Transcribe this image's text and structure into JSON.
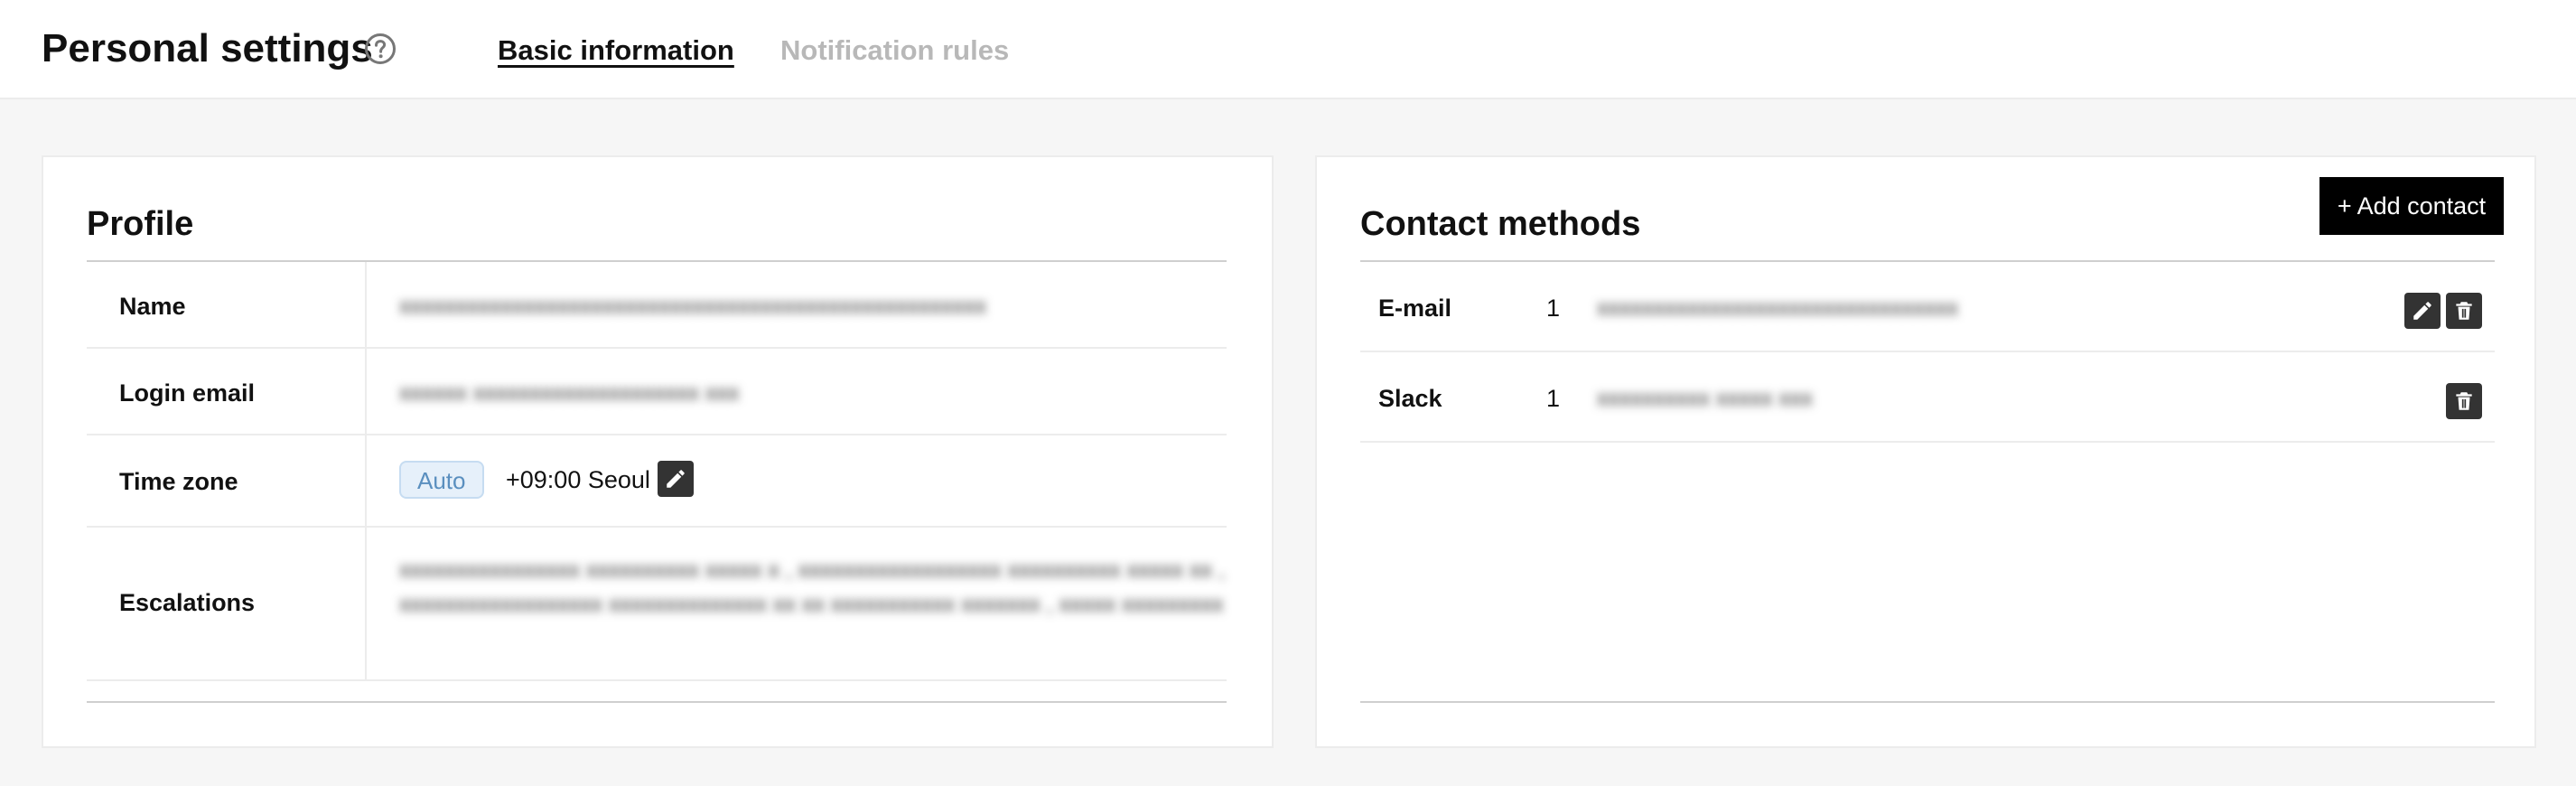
{
  "header": {
    "title": "Personal settings",
    "tabs": [
      {
        "label": "Basic information",
        "active": true
      },
      {
        "label": "Notification rules",
        "active": false
      }
    ]
  },
  "profile": {
    "title": "Profile",
    "rows": [
      {
        "label": "Name",
        "value": ""
      },
      {
        "label": "Login email",
        "value": ""
      },
      {
        "label": "Time zone",
        "badge": "Auto",
        "value": "+09:00 Seoul"
      },
      {
        "label": "Escalations",
        "value": ""
      }
    ]
  },
  "contact": {
    "title": "Contact methods",
    "add_label": "+ Add contact",
    "rows": [
      {
        "type": "E-mail",
        "count": "1",
        "value": ""
      },
      {
        "type": "Slack",
        "count": "1",
        "value": ""
      }
    ]
  },
  "colors": {
    "accent": "#000000",
    "badge_text": "#5a8fbf",
    "badge_bg": "#e6f0fa",
    "tab_inactive": "#b8b8b8"
  },
  "icons": {
    "help": "question-circle-icon",
    "edit": "pencil-icon",
    "delete": "trash-icon"
  }
}
